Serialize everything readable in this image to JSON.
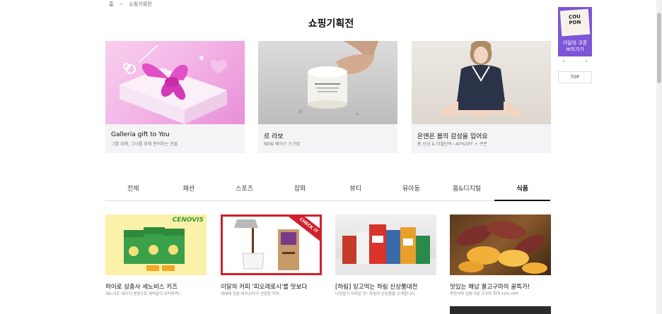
{
  "breadcrumb": {
    "home": "홈",
    "separator": ">",
    "current": "쇼핑기획전"
  },
  "page": {
    "title": "쇼핑기획전"
  },
  "banners": [
    {
      "title": "Galleria gift to You",
      "subtitle": "그를 위해, 그녀를 위해 준비하는 선물"
    },
    {
      "title": "르 라보",
      "subtitle": "NEW 베이스 스크럽"
    },
    {
      "title": "온앤온 봄의 감성을 입어요",
      "subtitle": "봄 신상 & 이월단독~40%OFF + 쿠폰"
    }
  ],
  "tabs": [
    {
      "label": "전체"
    },
    {
      "label": "패션"
    },
    {
      "label": "스포츠"
    },
    {
      "label": "잡화"
    },
    {
      "label": "뷰티"
    },
    {
      "label": "유아동"
    },
    {
      "label": "홈&디지털"
    },
    {
      "label": "식품"
    }
  ],
  "active_tab_index": 7,
  "products": [
    {
      "title": "허어로 삼총사 세노비스 키즈",
      "subtitle": "세노키즈 세가지 영양으로 새싹같이 무럭무럭!",
      "brand": "CENOVIS"
    },
    {
      "title": "이달의 커피 '피오레로시'를 맛보다",
      "subtitle": "레레레 전문 바리스타가 선정한 커피",
      "badge": "CHECK IT"
    },
    {
      "title": "[하림] 믿고먹는 하림 신상품대전",
      "subtitle": "나만알기 아까운 맛! 하림의 신상품을 소개합니다."
    },
    {
      "title": "맛있는 해남 꿀고구마의 골특가!",
      "subtitle": "착한식탁 임동기념 고구마 최대 10% OFF"
    }
  ],
  "sidebar": {
    "coupon_logo_line1": "COU",
    "coupon_logo_line2": "PON",
    "coupon_text_line1": "이달의 쿠폰",
    "coupon_text_line2": "보러가기",
    "prev_arrow": "‹",
    "next_arrow": "›",
    "top_label": "TOP"
  },
  "colors": {
    "accent_red": "#d0202b",
    "coupon_purple": "#7c55d8",
    "cenovis_green": "#3a9b3a"
  }
}
